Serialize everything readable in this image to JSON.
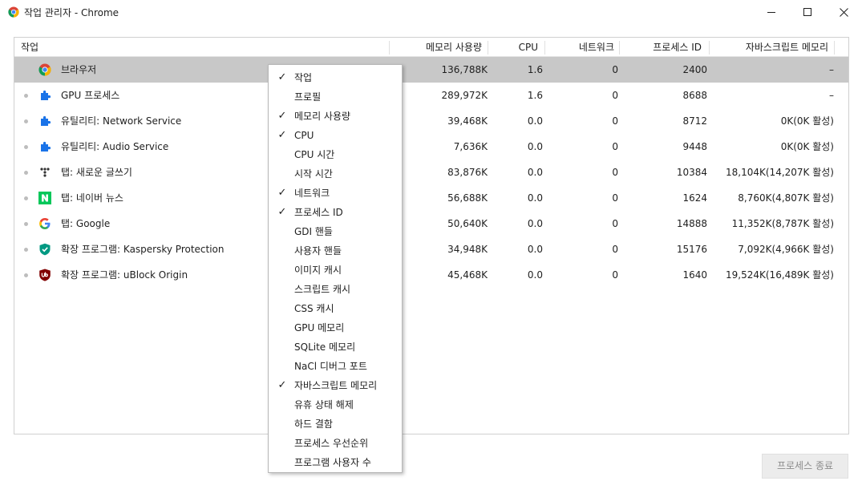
{
  "window": {
    "title": "작업 관리자 - Chrome"
  },
  "table": {
    "columns": [
      "작업",
      "메모리 사용량",
      "CPU",
      "네트워크",
      "프로세스 ID",
      "자바스크립트 메모리"
    ],
    "rows": [
      {
        "task": "브라우저",
        "icon": "chrome-icon",
        "memory": "136,788K",
        "cpu": "1.6",
        "network": "0",
        "pid": "2400",
        "js": "–"
      },
      {
        "task": "GPU 프로세스",
        "icon": "puzzle-icon",
        "memory": "289,972K",
        "cpu": "1.6",
        "network": "0",
        "pid": "8688",
        "js": "–"
      },
      {
        "task": "유틸리티: Network Service",
        "icon": "puzzle-icon",
        "memory": "39,468K",
        "cpu": "0.0",
        "network": "0",
        "pid": "8712",
        "js": "0K(0K 활성)"
      },
      {
        "task": "유틸리티: Audio Service",
        "icon": "puzzle-icon",
        "memory": "7,636K",
        "cpu": "0.0",
        "network": "0",
        "pid": "9448",
        "js": "0K(0K 활성)"
      },
      {
        "task": "탭: 새로운 글쓰기",
        "icon": "dots-icon",
        "memory": "83,876K",
        "cpu": "0.0",
        "network": "0",
        "pid": "10384",
        "js": "18,104K(14,207K 활성)"
      },
      {
        "task": "탭: 네이버 뉴스",
        "icon": "naver-icon",
        "memory": "56,688K",
        "cpu": "0.0",
        "network": "0",
        "pid": "1624",
        "js": "8,760K(4,807K 활성)"
      },
      {
        "task": "탭: Google",
        "icon": "google-icon",
        "memory": "50,640K",
        "cpu": "0.0",
        "network": "0",
        "pid": "14888",
        "js": "11,352K(8,787K 활성)"
      },
      {
        "task": "확장 프로그램: Kaspersky Protection",
        "icon": "kaspersky-icon",
        "memory": "34,948K",
        "cpu": "0.0",
        "network": "0",
        "pid": "15176",
        "js": "7,092K(4,966K 활성)"
      },
      {
        "task": "확장 프로그램: uBlock Origin",
        "icon": "ublock-icon",
        "memory": "45,468K",
        "cpu": "0.0",
        "network": "0",
        "pid": "1640",
        "js": "19,524K(16,489K 활성)"
      }
    ]
  },
  "menu": {
    "items": [
      {
        "label": "작업",
        "checked": true
      },
      {
        "label": "프로필",
        "checked": false
      },
      {
        "label": "메모리 사용량",
        "checked": true
      },
      {
        "label": "CPU",
        "checked": true
      },
      {
        "label": "CPU 시간",
        "checked": false
      },
      {
        "label": "시작 시간",
        "checked": false
      },
      {
        "label": "네트워크",
        "checked": true
      },
      {
        "label": "프로세스 ID",
        "checked": true
      },
      {
        "label": "GDI 핸들",
        "checked": false
      },
      {
        "label": "사용자 핸들",
        "checked": false
      },
      {
        "label": "이미지 캐시",
        "checked": false
      },
      {
        "label": "스크립트 캐시",
        "checked": false
      },
      {
        "label": "CSS 캐시",
        "checked": false
      },
      {
        "label": "GPU 메모리",
        "checked": false
      },
      {
        "label": "SQLite 메모리",
        "checked": false
      },
      {
        "label": "NaCl 디버그 포트",
        "checked": false
      },
      {
        "label": "자바스크립트 메모리",
        "checked": true
      },
      {
        "label": "유휴 상태 해제",
        "checked": false
      },
      {
        "label": "하드 결함",
        "checked": false
      },
      {
        "label": "프로세스 우선순위",
        "checked": false
      },
      {
        "label": "프로그램 사용자 수",
        "checked": false
      }
    ]
  },
  "footer": {
    "end_process_label": "프로세스 종료"
  },
  "colors": {
    "selected_row": "#c8c8c8",
    "chrome_red": "#db4437",
    "chrome_green": "#0f9d58",
    "chrome_yellow": "#f4b400",
    "chrome_blue": "#4285f4",
    "naver_green": "#03c75a",
    "puzzle_blue": "#1a73e8"
  }
}
